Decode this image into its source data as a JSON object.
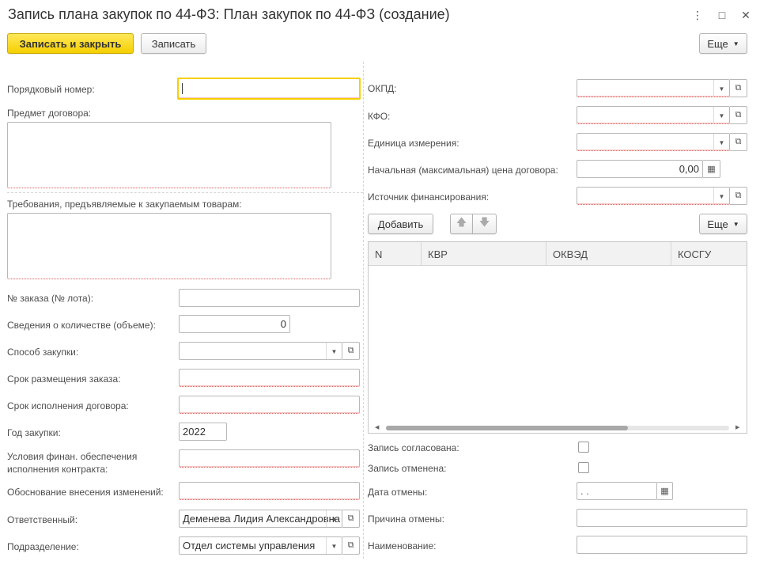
{
  "window": {
    "title": "Запись плана закупок по 44-ФЗ: План закупок по 44-ФЗ (создание)",
    "menu_icon": "⋮",
    "maximize_icon": "□",
    "close_icon": "✕"
  },
  "toolbar": {
    "save_close": "Записать и закрыть",
    "save": "Записать",
    "more": "Еще"
  },
  "left": {
    "seq_number_label": "Порядковый номер:",
    "seq_number_value": "",
    "contract_subject_label": "Предмет договора:",
    "requirements_label": "Требования, предъявляемые к закупаемым товарам:",
    "order_number_label": "№ заказа (№ лота):",
    "order_number_value": "",
    "quantity_label": "Сведения о количестве (объеме):",
    "quantity_value": "0",
    "method_label": "Способ закупки:",
    "method_value": "",
    "placement_term_label": "Срок размещения заказа:",
    "placement_term_value": "",
    "execution_term_label": "Срок исполнения договора:",
    "execution_term_value": "",
    "year_label": "Год закупки:",
    "year_value": "2022",
    "financial_cond_label_1": "Условия финан. обеспечения",
    "financial_cond_label_2": "исполнения контракта:",
    "financial_cond_value": "",
    "change_reason_label": "Обоснование внесения изменений:",
    "change_reason_value": "",
    "responsible_label": "Ответственный:",
    "responsible_value": "Деменева Лидия Александровна",
    "department_label": "Подразделение:",
    "department_value": "Отдел системы управления"
  },
  "right": {
    "okpd_label": "ОКПД:",
    "okpd_value": "",
    "kfo_label": "КФО:",
    "kfo_value": "",
    "unit_label": "Единица измерения:",
    "unit_value": "",
    "price_label": "Начальная (максимальная) цена договора:",
    "price_value": "0,00",
    "source_label": "Источник финансирования:",
    "source_value": "",
    "add_button": "Добавить",
    "more": "Еще",
    "columns": [
      "N",
      "КВР",
      "ОКВЭД",
      "КОСГУ"
    ],
    "agreed_label": "Запись согласована:",
    "cancelled_label": "Запись отменена:",
    "cancel_date_label": "Дата отмены:",
    "cancel_date_value": " .  .",
    "cancel_reason_label": "Причина отмены:",
    "cancel_reason_value": "",
    "name_label": "Наименование:",
    "name_value": ""
  }
}
